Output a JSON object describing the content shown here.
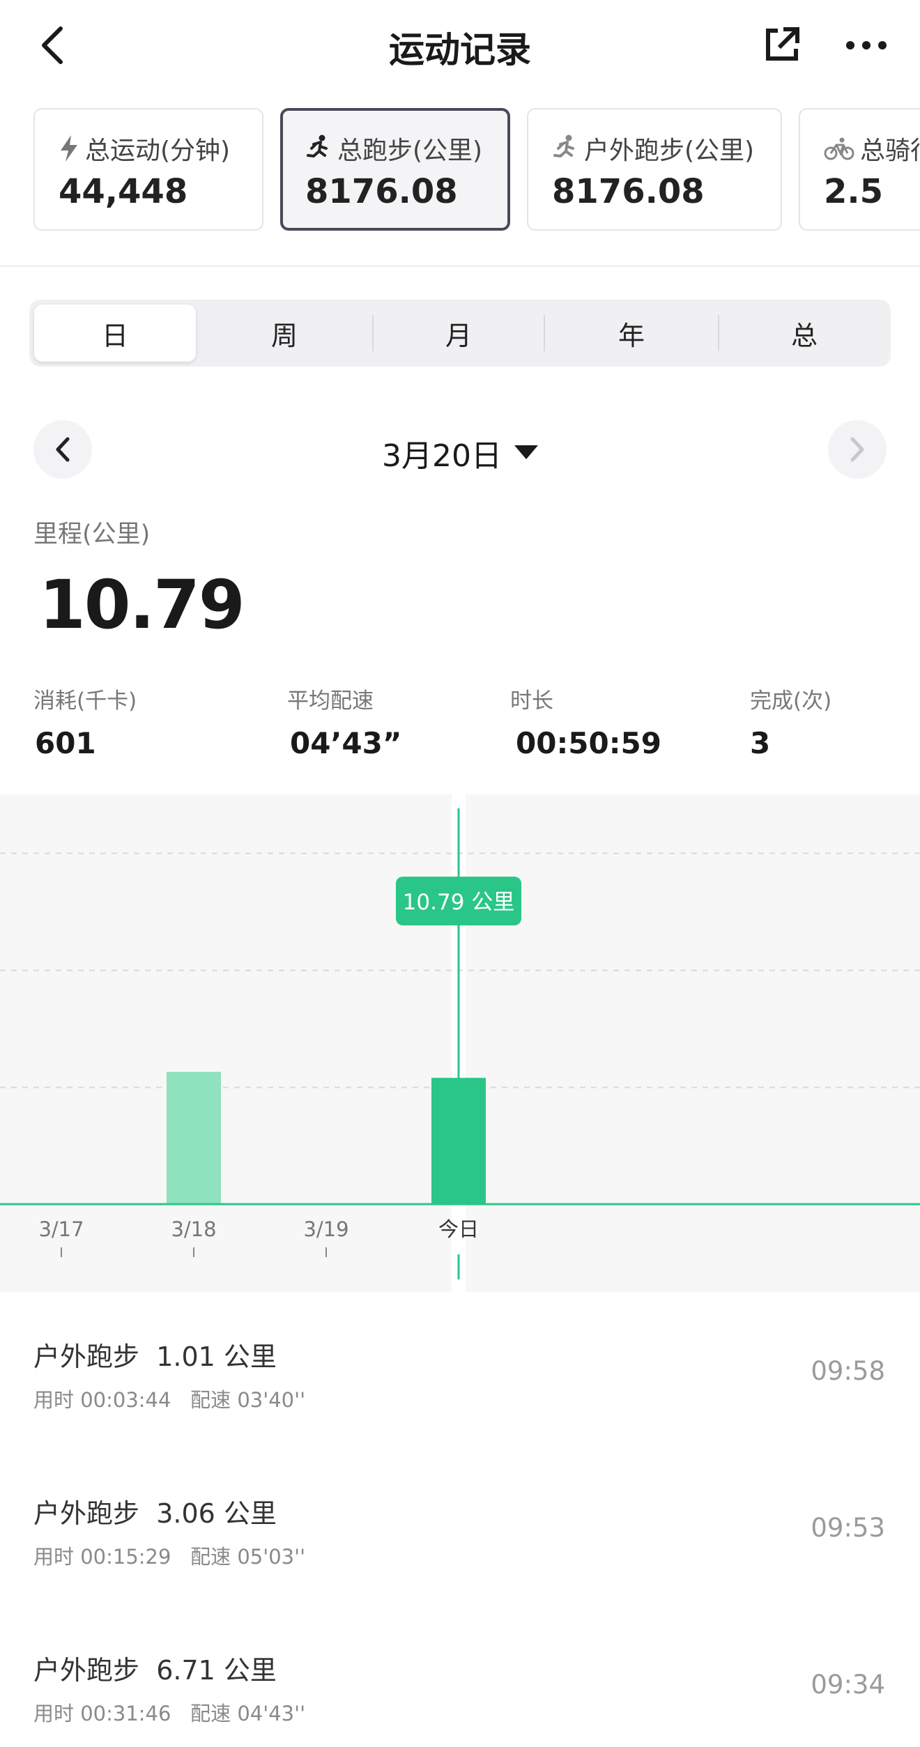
{
  "header": {
    "title": "运动记录",
    "back_icon": "chevron-left-icon",
    "share_icon": "share-external-icon",
    "more_icon": "more-dots-icon"
  },
  "cards": [
    {
      "icon": "lightning-icon",
      "label": "总运动(分钟)",
      "value": "44,448"
    },
    {
      "icon": "run-icon",
      "label": "总跑步(公里)",
      "value": "8176.08"
    },
    {
      "icon": "run-icon",
      "label": "户外跑步(公里)",
      "value": "8176.08"
    },
    {
      "icon": "bike-icon",
      "label": "总骑行",
      "value": "2.5"
    }
  ],
  "tabs": [
    "日",
    "周",
    "月",
    "年",
    "总"
  ],
  "active_tab": "日",
  "date_label": "3月20日",
  "metric": {
    "title": "里程(公里)",
    "value": "10.79"
  },
  "stats": [
    {
      "label": "消耗(千卡)",
      "value": "601"
    },
    {
      "label": "平均配速",
      "value": "04’43”"
    },
    {
      "label": "时长",
      "value": "00:50:59"
    },
    {
      "label": "完成(次)",
      "value": "3"
    }
  ],
  "chart_data": {
    "type": "bar",
    "categories": [
      "3/17",
      "3/18",
      "3/19",
      "今日"
    ],
    "values": [
      0,
      11.3,
      0,
      10.79
    ],
    "selected": "今日",
    "tooltip": "10.79 公里",
    "ylim": [
      0,
      30
    ],
    "grid": true
  },
  "activities": [
    {
      "title": "户外跑步",
      "distance": "1.01 公里",
      "duration": "用时 00:03:44",
      "pace": "配速 03'40''",
      "time": "09:58"
    },
    {
      "title": "户外跑步",
      "distance": "3.06 公里",
      "duration": "用时 00:15:29",
      "pace": "配速 05'03''",
      "time": "09:53"
    },
    {
      "title": "户外跑步",
      "distance": "6.71 公里",
      "duration": "用时 00:31:46",
      "pace": "配速 04'43''",
      "time": "09:34"
    }
  ],
  "colors": {
    "accent": "#2ac687",
    "accent_light": "#8ee2be",
    "active_border": "#4d4759"
  }
}
